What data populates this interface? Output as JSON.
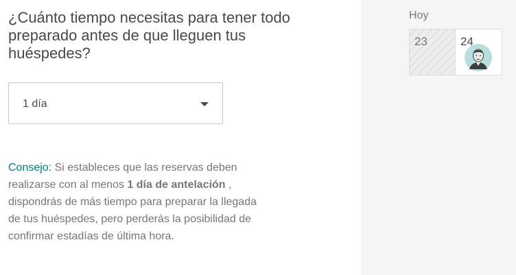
{
  "question": {
    "line1": "¿Cuánto tiempo necesitas para tener todo",
    "line2": "preparado antes de que lleguen tus",
    "line3": "huéspedes?"
  },
  "select": {
    "value": "1 día",
    "caret_icon": "chevron-down-icon"
  },
  "tip": {
    "label": "Consejo:",
    "text_before": "Si estableces que las reservas deben realizarse con al menos",
    "bold": "1 día de antelación",
    "text_after": ", dispondrás de más tiempo para preparar la llegada de tus huéspedes, pero perderás la posibilidad de confirmar estadías de última hora.",
    "label_color": "#007a87"
  },
  "calendar": {
    "today_label": "Hoy",
    "days": [
      {
        "number": "23",
        "state": "unavailable"
      },
      {
        "number": "24",
        "state": "guest-arrival"
      }
    ],
    "avatar_icon": "guest-avatar-icon"
  }
}
